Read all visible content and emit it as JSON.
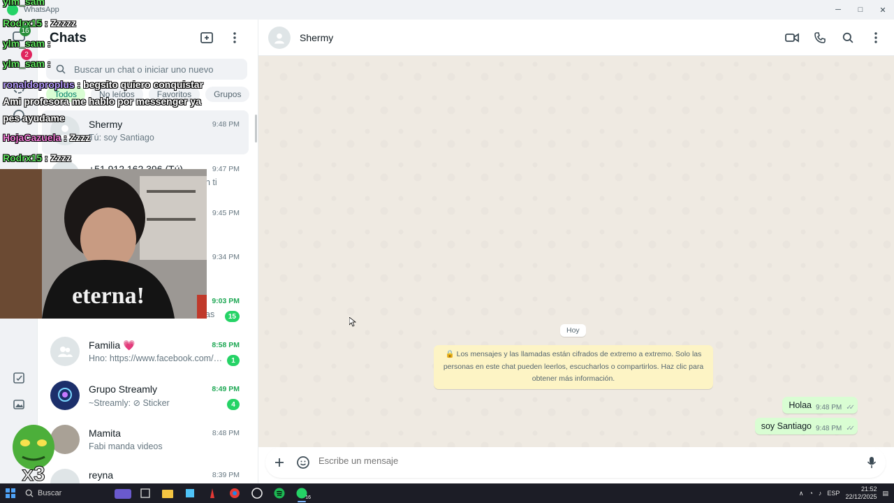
{
  "window": {
    "title": "WhatsApp"
  },
  "sidebar": {
    "title": "Chats",
    "rail_badges": {
      "chats": "16",
      "status": "2"
    },
    "search_placeholder": "Buscar un chat o iniciar uno nuevo",
    "filters": [
      {
        "label": "Todos",
        "active": true
      },
      {
        "label": "No leídos",
        "active": false
      },
      {
        "label": "Favoritos",
        "active": false
      },
      {
        "label": "Grupos",
        "active": false
      }
    ],
    "chats": [
      {
        "name": "Shermy",
        "preview": "Tú: soy Santiago",
        "time": "9:48 PM",
        "unread_count": "",
        "selected": true
      },
      {
        "name": "+51 912 162 396 (Tú)",
        "preview": "n ti",
        "time": "9:47 PM",
        "unread_count": ""
      },
      {
        "name": "",
        "preview": "",
        "time": "9:45 PM",
        "unread_count": ""
      },
      {
        "name": "",
        "preview": "",
        "time": "9:34 PM",
        "unread_count": ""
      },
      {
        "name": "",
        "preview": "as",
        "time": "9:03 PM",
        "unread_count": "15"
      },
      {
        "name": "Familia 💗",
        "preview": "Hno: https://www.facebook.com/sh...",
        "time": "8:58 PM",
        "unread_count": "1"
      },
      {
        "name": "Grupo Streamly",
        "preview": "~Streamly: ⊘ Sticker",
        "time": "8:49 PM",
        "unread_count": "4"
      },
      {
        "name": "Mamita",
        "preview": "Fabi manda videos",
        "time": "8:48 PM",
        "unread_count": ""
      },
      {
        "name": "reyna",
        "preview": "",
        "time": "8:39 PM",
        "unread_count": ""
      }
    ]
  },
  "conversation": {
    "contact_name": "Shermy",
    "day_label": "Hoy",
    "encryption_notice": "🔒 Los mensajes y las llamadas están cifrados de extremo a extremo. Solo las personas en este chat pueden leerlos, escucharlos o compartirlos. Haz clic para obtener más información.",
    "messages": [
      {
        "text": "Holaa",
        "time": "9:48 PM",
        "ticks": "✓✓"
      },
      {
        "text": "soy Santiago",
        "time": "9:48 PM",
        "ticks": "✓✓"
      }
    ],
    "composer_placeholder": "Escribe un mensaje"
  },
  "stream_chat": [
    {
      "user": "ylm_sam",
      "sep": "",
      "msg": "",
      "color": "green"
    },
    {
      "user": "Rodrx15",
      "sep": " : ",
      "msg": "Zzzzz",
      "color": "green"
    },
    {
      "user": "ylm_sam",
      "sep": " : ",
      "msg": "",
      "color": "green"
    },
    {
      "user": "ylm_sam",
      "sep": " : ",
      "msg": "",
      "color": "green"
    },
    {
      "user": "ronaldoproplus",
      "sep": " : ",
      "msg": "begsito quiero conquistar",
      "color": "violet"
    },
    {
      "user": "",
      "sep": "",
      "msg": "Ami profesora me hablo por messenger ya",
      "color": "green"
    },
    {
      "user": "",
      "sep": "",
      "msg": "pes ayudame",
      "color": "green"
    },
    {
      "user": "HojaCazuela",
      "sep": " : ",
      "msg": "Zzzz",
      "color": "pink"
    },
    {
      "user": "Rodrx15",
      "sep": " : ",
      "msg": "Zzzz",
      "color": "green"
    }
  ],
  "webcam": {
    "shirt_text": "eterna!"
  },
  "taskbar": {
    "search_label": "Buscar",
    "whatsapp_badge": "16",
    "language": "ESP",
    "time": "21:52",
    "date": "22/12/2025"
  },
  "colors": {
    "accent": "#25d366",
    "bubble_out": "#d9fdd3",
    "wallpaper": "#efeae2",
    "notice": "#fdf4c5"
  }
}
